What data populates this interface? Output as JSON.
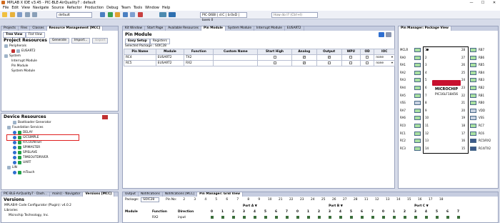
{
  "window": {
    "title": "MPLAB X IDE v3.45 - PIC-BLE-AirQuality7 : default",
    "min": "—",
    "max": "☐",
    "close": "✕"
  },
  "menu": [
    "File",
    "Edit",
    "View",
    "Navigate",
    "Source",
    "Refactor",
    "Production",
    "Debug",
    "Team",
    "Tools",
    "Window",
    "Help"
  ],
  "toolbar": {
    "config": "default",
    "device_box": "PIC-D6BI  |  d:C |  b:0xD |  bank 0",
    "search_placeholder": "How do I?  (Ctrl+I)"
  },
  "left_tabs": [
    "Projects",
    "Files",
    "Classes",
    "Resource Management [MCC]"
  ],
  "sub_tabs": [
    "Tree View",
    "Flat View"
  ],
  "project_resources": {
    "title": "Project Resources",
    "buttons": [
      "Generate",
      "Import...",
      "Export"
    ],
    "items": [
      "Peripherals",
      "EUSART2",
      "System",
      "Interrupt Module",
      "Pin Module",
      "System Module"
    ]
  },
  "device_resources": {
    "title": "Device Resources",
    "items": [
      "Bootloader Generator",
      "Foundation Services",
      "DELAY",
      "I2CSIMPLE",
      "RTCOUNTER",
      "SPIMASTER",
      "SPISLAVE",
      "TIMEOUTDRIVER",
      "UART",
      "LIN",
      "mTouch"
    ]
  },
  "nav_tabs": [
    "PIC-BLE-AirQuality7 - Dash...",
    "main() - Navigator",
    "Versions [MCC]"
  ],
  "versions": {
    "title": "Versions",
    "items": [
      "MPLAB® Code Configurator (Plugin): v4.0.2",
      "Libraries",
      "Microchip Technology, Inc."
    ]
  },
  "center_tabs": [
    "Kit Window",
    "Start Page",
    "Available Resources",
    "Pin Module",
    "System Module",
    "Interrupt Module",
    "EUSART2"
  ],
  "pin_module": {
    "title": "Pin Module",
    "sub_tabs": [
      "Easy Setup",
      "Registers"
    ],
    "selected_package": "Selected Package : SOIC28",
    "columns": [
      "Pin Name",
      "Module",
      "Function",
      "Custom Name",
      "Start High",
      "Analog",
      "Output",
      "WPU",
      "OD",
      "IOC"
    ],
    "rows": [
      [
        "RC4",
        "EUSART2",
        "TX2",
        "",
        "",
        "✓",
        "✓",
        "",
        "",
        "none"
      ],
      [
        "RC5",
        "EUSART2",
        "RX2",
        "",
        "",
        "✓",
        "",
        "",
        "",
        "none"
      ]
    ]
  },
  "bottom_tabs": [
    "Output",
    "Notifications",
    "Notifications [MCC]",
    "Pin Manager: Grid View"
  ],
  "grid": {
    "package_label": "Package:",
    "package": "SOIC28",
    "pinno_label": "Pin No:",
    "pins": [
      "2",
      "3",
      "4",
      "5",
      "6",
      "7",
      "8",
      "9",
      "10",
      "21",
      "22",
      "23",
      "24",
      "25",
      "26",
      "27",
      "28",
      "11",
      "12",
      "13",
      "14",
      "15",
      "16",
      "17",
      "18"
    ],
    "port_a": "Port A ▼",
    "port_b": "Port B ▼",
    "port_c": "Port C ▼",
    "cols": [
      "Module",
      "Function",
      "Direction",
      "0",
      "1",
      "2",
      "3",
      "4",
      "5",
      "6",
      "7",
      "0",
      "1",
      "2",
      "3",
      "4",
      "5",
      "6",
      "7",
      "0",
      "1",
      "2",
      "3",
      "4",
      "5",
      "6",
      "7"
    ],
    "row": [
      "",
      "RX2",
      "input"
    ]
  },
  "pin_manager": {
    "title": "Pin Manager: Package View",
    "chip": "PIC16LF18456",
    "brand": "MICROCHIP",
    "left": [
      "MCLR",
      "RA0",
      "RA1",
      "RA2",
      "RA3",
      "RA4",
      "RA5",
      "VSS",
      "RA7",
      "RA6",
      "RC0",
      "RC1",
      "RC2",
      "RC3"
    ],
    "right": [
      "RB7",
      "RB6",
      "RB5",
      "RB4",
      "RB3",
      "RB2",
      "RB1",
      "RB0",
      "VDD",
      "VSS",
      "RC7",
      "RC6",
      "RC5/RX2",
      "RC4/TX2"
    ],
    "left_nums": [
      "1",
      "2",
      "3",
      "4",
      "5",
      "6",
      "7",
      "8",
      "9",
      "10",
      "11",
      "12",
      "13",
      "14"
    ],
    "right_nums": [
      "28",
      "27",
      "26",
      "25",
      "24",
      "23",
      "22",
      "21",
      "20",
      "19",
      "18",
      "17",
      "16",
      "15"
    ]
  }
}
